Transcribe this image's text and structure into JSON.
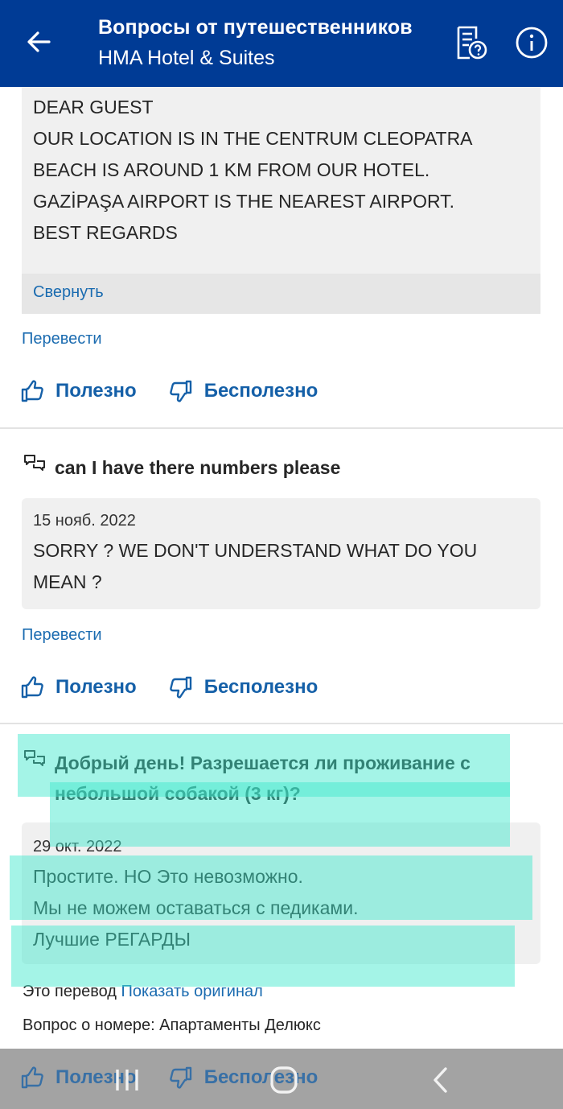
{
  "header": {
    "title": "Вопросы от путешественников",
    "subtitle": "HMA Hotel & Suites"
  },
  "answer1": {
    "lines": [
      "DEAR GUEST",
      "OUR LOCATION IS IN THE CENTRUM CLEOPATRA",
      "BEACH IS AROUND 1 KM FROM OUR HOTEL.",
      "GAZİPAŞA AIRPORT IS THE NEAREST AIRPORT.",
      "BEST REGARDS"
    ],
    "collapse_label": "Свернуть",
    "translate_label": "Перевести",
    "helpful_label": "Полезно",
    "unhelpful_label": "Бесполезно"
  },
  "qa2": {
    "question": "can I have there numbers please",
    "date": "15 нояб. 2022",
    "answer_lines": [
      "SORRY ? WE DON'T UNDERSTAND WHAT DO YOU",
      "MEAN ?"
    ],
    "translate_label": "Перевести",
    "helpful_label": "Полезно",
    "unhelpful_label": "Бесполезно"
  },
  "qa3": {
    "question_lines": [
      "Добрый день! Разрешается ли проживание с",
      "небольшой собакой (3 кг)?"
    ],
    "date": "29 окт. 2022",
    "answer_lines": [
      "Простите. НО Это невозможно.",
      "Мы не можем оставаться с педиками.",
      "Лучшие РЕГАРДЫ"
    ],
    "translation_note": "Это перевод",
    "show_original_label": "Показать оригинал",
    "room_info": "Вопрос о номере: Апартаменты Делюкс",
    "helpful_label": "Полезно",
    "unhelpful_label": "Бесполезно"
  },
  "colors": {
    "brand": "#003b95",
    "link": "#1a6bb0",
    "highlight": "#40e8cd"
  },
  "icons": {
    "back": "arrow-left-icon",
    "qa": "question-document-icon",
    "info": "info-icon",
    "question": "speech-bubbles-icon",
    "helpful": "thumbs-up-icon",
    "unhelpful": "thumbs-down-icon"
  }
}
